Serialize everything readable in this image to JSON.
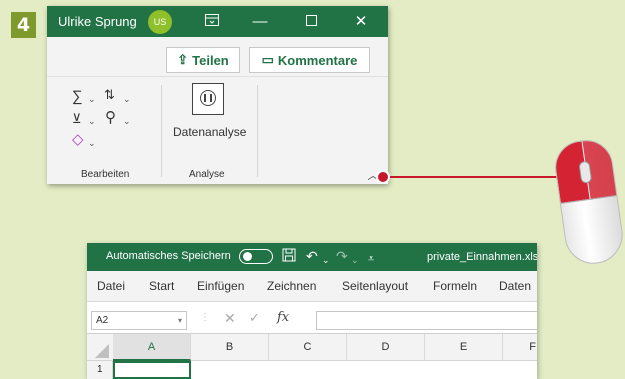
{
  "step": {
    "number": "4"
  },
  "ribbon_window": {
    "user_name": "Ulrike Sprung",
    "avatar_initials": "US",
    "share_label": "Teilen",
    "comments_label": "Kommentare",
    "groups": [
      {
        "label": "Bearbeiten"
      },
      {
        "label": "Analyse"
      }
    ],
    "data_analysis_label": "Datenanalyse",
    "colors": {
      "titlebar": "#217346",
      "accent": "#217346"
    }
  },
  "pointer": {
    "color": "#c8182b"
  },
  "excel_window": {
    "autosave_label": "Automatisches Speichern",
    "filename": "private_Einnahmen.xls",
    "tabs": [
      "Datei",
      "Start",
      "Einfügen",
      "Zeichnen",
      "Seitenlayout",
      "Formeln",
      "Daten"
    ],
    "name_box_value": "A2",
    "fx_label": "fx",
    "columns": [
      "A",
      "B",
      "C",
      "D",
      "E",
      "F"
    ],
    "rows": [
      "1"
    ]
  }
}
